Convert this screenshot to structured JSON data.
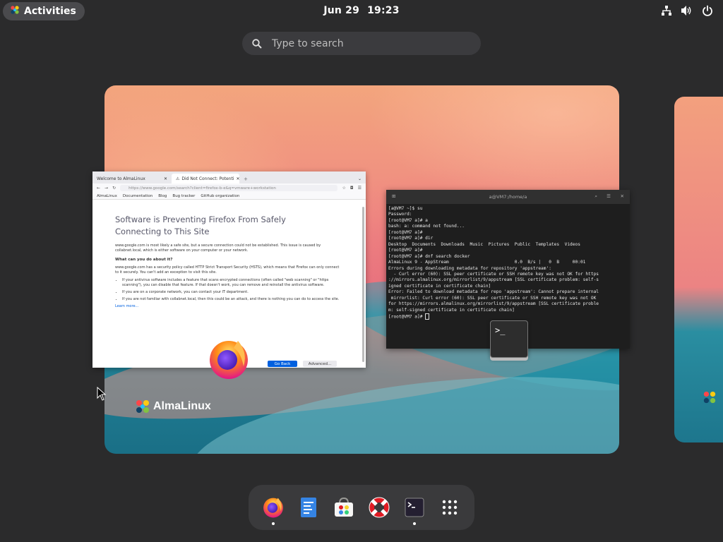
{
  "topbar": {
    "activities_label": "Activities",
    "date": "Jun 29",
    "time": "19:23"
  },
  "search": {
    "placeholder": "Type to search"
  },
  "workspace": {
    "brand": "AlmaLinux"
  },
  "firefox": {
    "tabs": [
      "Welcome to AlmaLinux",
      "Did Not Connect: Potenti"
    ],
    "url": "https://www.google.com/search?client=firefox-b-e&q=vmware+workstation",
    "bookmarks": [
      "AlmaLinux",
      "Documentation",
      "Blog",
      "Bug tracker",
      "GitHub organization"
    ],
    "error_title_line1": "Software is Preventing Firefox From Safely",
    "error_title_line2": "Connecting to This Site",
    "para1": "www.google.com is most likely a safe site, but a secure connection could not be established. This issue is caused by collabnet.local, which is either software on your computer or your network.",
    "heading": "What can you do about it?",
    "para2": "www.google.com has a security policy called HTTP Strict Transport Security (HSTS), which means that Firefox can only connect to it securely. You can't add an exception to visit this site.",
    "bullets": [
      "If your antivirus software includes a feature that scans encrypted connections (often called \"web scanning\" or \"https scanning\"), you can disable that feature. If that doesn't work, you can remove and reinstall the antivirus software.",
      "If you are on a corporate network, you can contact your IT department.",
      "If you are not familiar with collabnet.local, then this could be an attack, and there is nothing you can do to access the site."
    ],
    "learn_more": "Learn more...",
    "go_back": "Go Back",
    "advanced": "Advanced..."
  },
  "terminal": {
    "title": "a@VM7:/home/a",
    "lines": [
      "[a@VM7 ~]$ su",
      "Password:",
      "[root@VM7 a]# a",
      "bash: a: command not found...",
      "[root@VM7 a]#",
      "[root@VM7 a]# dir",
      "Desktop  Documents  Downloads  Music  Pictures  Public  Templates  Videos",
      "[root@VM7 a]#",
      "[root@VM7 a]# dnf search docker",
      "AlmaLinux 9 - AppStream                         0.0  B/s |   0  B     00:01",
      "Errors during downloading metadata for repository 'appstream':",
      "  - Curl error (60): SSL peer certificate or SSH remote key was not OK for https",
      "://mirrors.almalinux.org/mirrorlist/9/appstream [SSL certificate problem: self-s",
      "igned certificate in certificate chain]",
      "Error: Failed to download metadata for repo 'appstream': Cannot prepare internal",
      " mirrorlist: Curl error (60): SSL peer certificate or SSH remote key was not OK",
      "for https://mirrors.almalinux.org/mirrorlist/9/appstream [SSL certificate proble",
      "m: self-signed certificate in certificate chain]",
      "[root@VM7 a]# "
    ],
    "icon_glyph": ">_"
  },
  "dock": {
    "items": [
      {
        "icon": "firefox-icon",
        "running": true
      },
      {
        "icon": "text-editor-icon",
        "running": false
      },
      {
        "icon": "software-store-icon",
        "running": false
      },
      {
        "icon": "help-lifebuoy-icon",
        "running": false
      },
      {
        "icon": "terminal-icon",
        "running": true
      },
      {
        "icon": "app-grid-icon",
        "running": false
      }
    ]
  },
  "colors": {
    "panel": "#2b2b2c",
    "dock": "#3a3a3c",
    "firefox_blue": "#0060df",
    "terminal_bg": "#1e1e1e"
  }
}
